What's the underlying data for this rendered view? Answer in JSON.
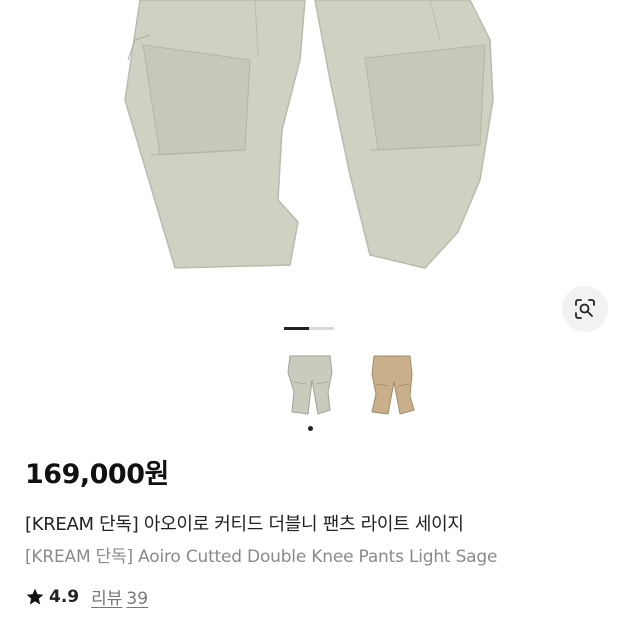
{
  "product": {
    "price": "169,000원",
    "title_ko": "[KREAM 단독] 아오이로 커티드 더블니 팬츠 라이트 세이지",
    "title_en": "[KREAM 단독] Aoiro Cutted Double Knee Pants Light Sage",
    "rating": "4.9",
    "review_label": "리뷰",
    "review_count": "39"
  },
  "gallery": {
    "active_index": 1,
    "total": 2,
    "thumbnail_colors": [
      "#c9cbbd",
      "#c9b08a"
    ]
  },
  "colors": {
    "pants_main": "#cfd1c3",
    "pants_shadow": "#b9bcad",
    "pants_tan": "#c8ae87"
  },
  "icons": {
    "lens": "visual-search-icon",
    "rating": "star-icon"
  }
}
